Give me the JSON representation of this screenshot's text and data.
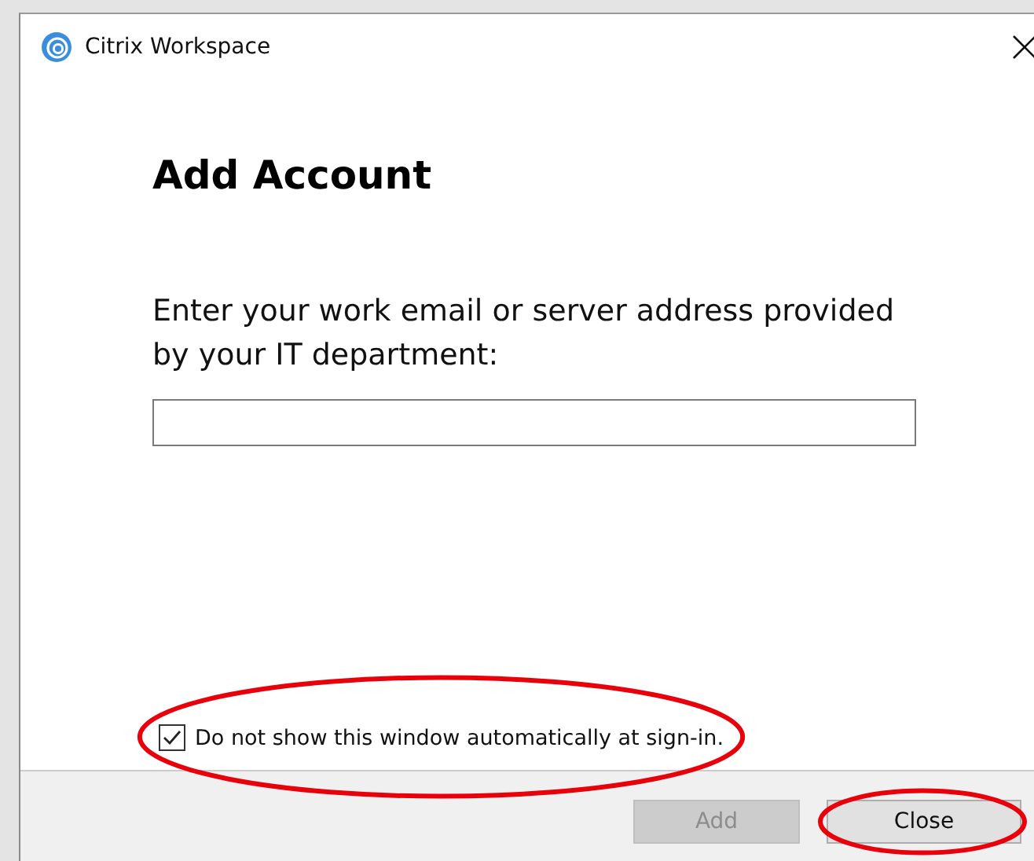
{
  "window": {
    "title": "Citrix Workspace"
  },
  "heading": "Add Account",
  "prompt": "Enter your work email or server address provided by your IT department:",
  "option": {
    "label": "Do not show this window automatically at sign-in.",
    "checked": true,
    "circled": true
  },
  "buttons": [
    {
      "label": "Add",
      "disabled": true,
      "circled": false
    },
    {
      "label": "Close",
      "disabled": false,
      "circled": true
    }
  ]
}
